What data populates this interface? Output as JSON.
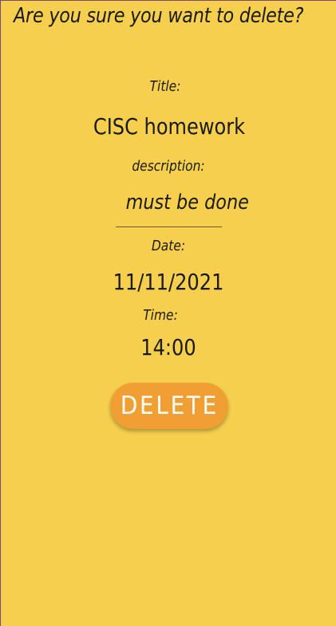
{
  "dialog": {
    "heading": "Are you sure you want to delete?"
  },
  "task": {
    "title_label": "Title:",
    "title_value": "CISC homework",
    "description_label": "description:",
    "description_value": "must be done",
    "date_label": "Date:",
    "date_value": "11/11/2021",
    "time_label": "Time:",
    "time_value": "14:00"
  },
  "actions": {
    "delete_label": "DELETE"
  },
  "colors": {
    "background": "#f5cf4d",
    "button": "#f0a033",
    "button_text": "#ffffff"
  }
}
